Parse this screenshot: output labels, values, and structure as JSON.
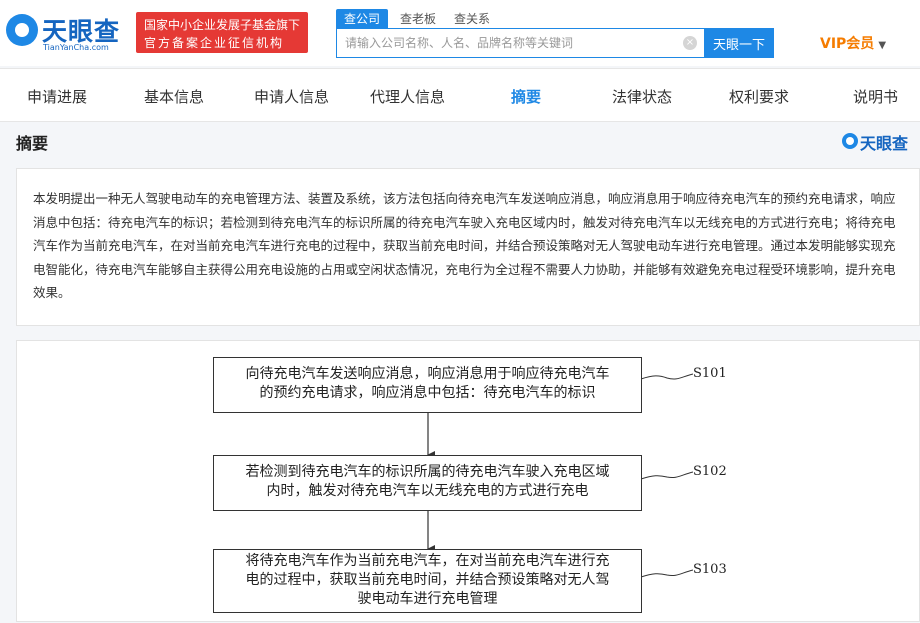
{
  "brand": {
    "name": "天眼查",
    "domain": "TianYanCha.com"
  },
  "gov_badge": {
    "line1": "国家中小企业发展子基金旗下",
    "line2": "官方备案企业征信机构"
  },
  "search": {
    "tabs": [
      "查公司",
      "查老板",
      "查关系"
    ],
    "active_tab": "查公司",
    "placeholder": "请输入公司名称、人名、品牌名称等关键词",
    "clear_icon": "×",
    "button_label": "天眼一下"
  },
  "vip": {
    "label": "VIP会员",
    "caret": "▼"
  },
  "nav": {
    "tabs": [
      "申请进展",
      "基本信息",
      "申请人信息",
      "代理人信息",
      "摘要",
      "法律状态",
      "权利要求",
      "说明书"
    ],
    "active_tab": "摘要"
  },
  "section": {
    "title": "摘要",
    "watermark": "天眼查"
  },
  "abstract": {
    "text": "本发明提出一种无人驾驶电动车的充电管理方法、装置及系统，该方法包括向待充电汽车发送响应消息，响应消息用于响应待充电汽车的预约充电请求，响应消息中包括：待充电汽车的标识；若检测到待充电汽车的标识所属的待充电汽车驶入充电区域内时，触发对待充电汽车以无线充电的方式进行充电；将待充电汽车作为当前充电汽车，在对当前充电汽车进行充电的过程中，获取当前充电时间，并结合预设策略对无人驾驶电动车进行充电管理。通过本发明能够实现充电智能化，待充电汽车能够自主获得公用充电设施的占用或空闲状态情况，充电行为全过程不需要人力协助，并能够有效避免充电过程受环境影响，提升充电效果。"
  },
  "flowchart": {
    "steps": [
      {
        "label": "S101",
        "lines": [
          "向待充电汽车发送响应消息，响应消息用于响应待充电汽车",
          "的预约充电请求，响应消息中包括：待充电汽车的标识"
        ]
      },
      {
        "label": "S102",
        "lines": [
          "若检测到待充电汽车的标识所属的待充电汽车驶入充电区域",
          "内时，触发对待充电汽车以无线充电的方式进行充电"
        ]
      },
      {
        "label": "S103",
        "lines": [
          "将待充电汽车作为当前充电汽车，在对当前充电汽车进行充",
          "电的过程中，获取当前充电时间，并结合预设策略对无人驾",
          "驶电动车进行充电管理"
        ]
      }
    ]
  },
  "colors": {
    "brand_blue": "#1e88e5",
    "logo_blue": "#1565c0",
    "badge_red": "#e53935",
    "vip_orange": "#f57c00",
    "page_bg": "#f4f6f9"
  }
}
